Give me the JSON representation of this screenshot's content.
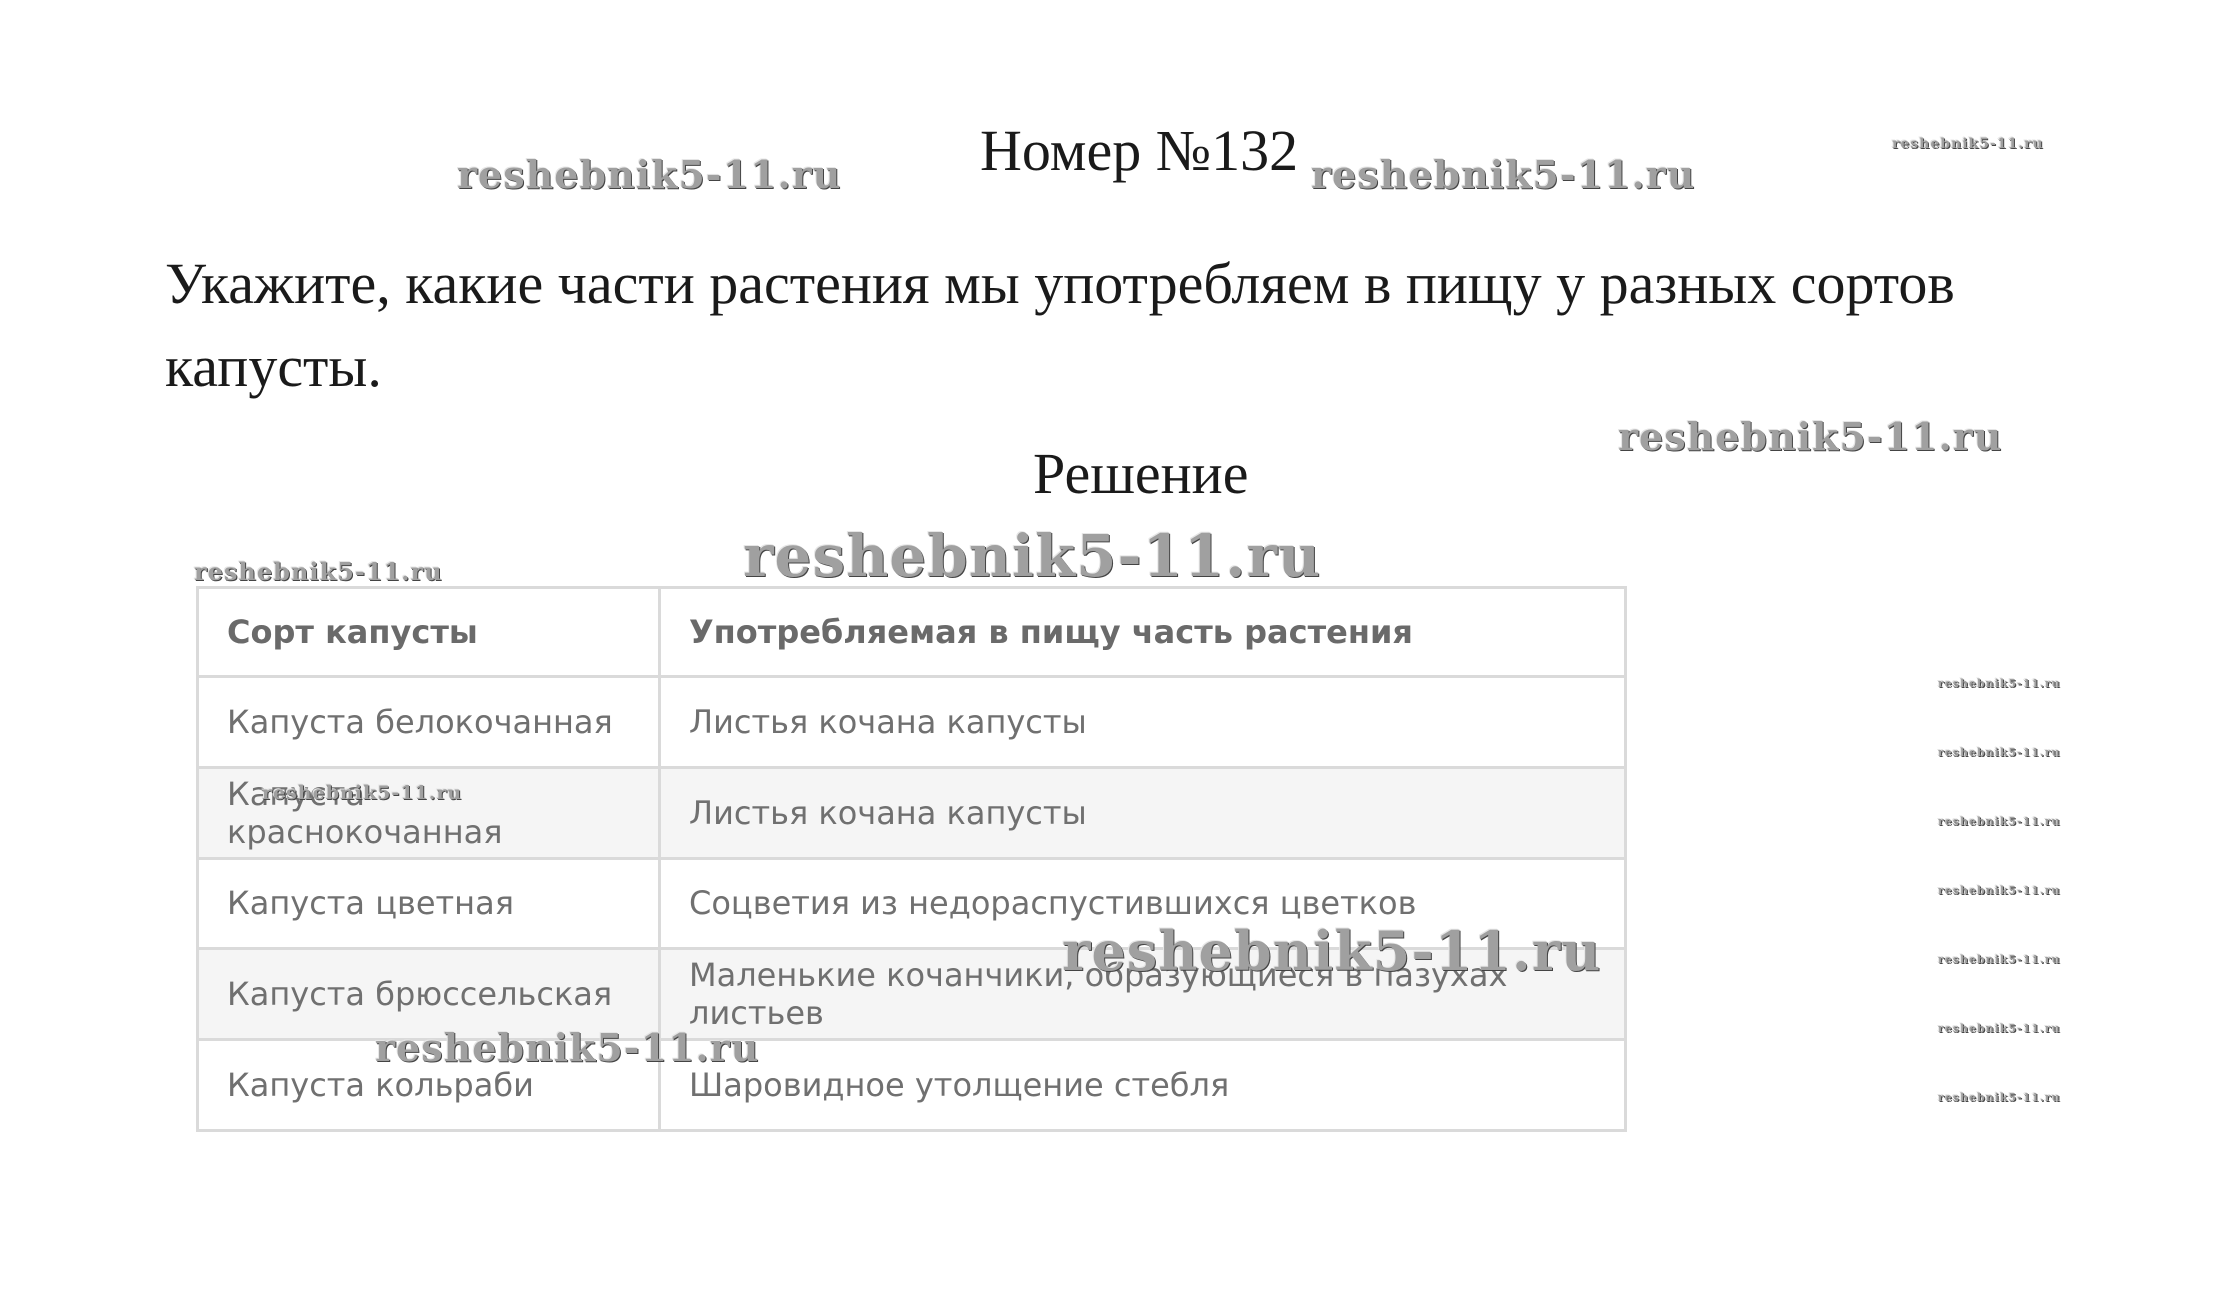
{
  "document": {
    "title": "Номер №132",
    "question": "Укажите, какие части растения мы употребляем в пищу у разных сортов капусты.",
    "solution_heading": "Решение"
  },
  "table": {
    "headers": [
      "Сорт капусты",
      "Употребляемая в пищу часть растения"
    ],
    "rows": [
      [
        "Капуста белокочанная",
        "Листья кочана капусты"
      ],
      [
        "Капуста краснокочанная",
        "Листья кочана капусты"
      ],
      [
        "Капуста цветная",
        "Соцветия из недораспустившихся цветков"
      ],
      [
        "Капуста брюссельская",
        "Маленькие кочанчики, образующиеся в пазухах листьев"
      ],
      [
        "Капуста кольраби",
        "Шаровидное утолщение стебля"
      ]
    ]
  },
  "watermark": {
    "text": "reshebnik5-11.ru"
  }
}
